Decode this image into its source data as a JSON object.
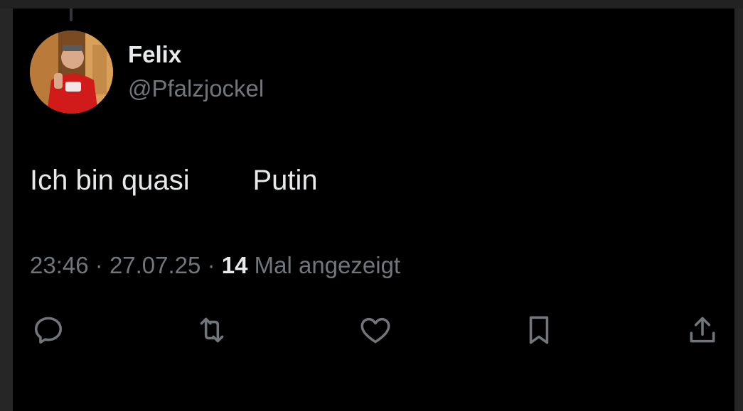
{
  "tweet": {
    "author_name": "Felix",
    "author_handle": "@Pfalzjockel",
    "text": "Ich bin quasi        Putin",
    "time": "23:46",
    "date": "27.07.25",
    "separator": "·",
    "views_count": "14",
    "views_label": "Mal angezeigt"
  },
  "actions": [
    {
      "icon": "reply-icon"
    },
    {
      "icon": "retweet-icon"
    },
    {
      "icon": "like-icon"
    },
    {
      "icon": "bookmark-icon"
    },
    {
      "icon": "share-icon"
    }
  ],
  "colors": {
    "background": "#000000",
    "text_primary": "#e7e9ea",
    "text_secondary": "#71767b",
    "icon": "#71767b"
  }
}
